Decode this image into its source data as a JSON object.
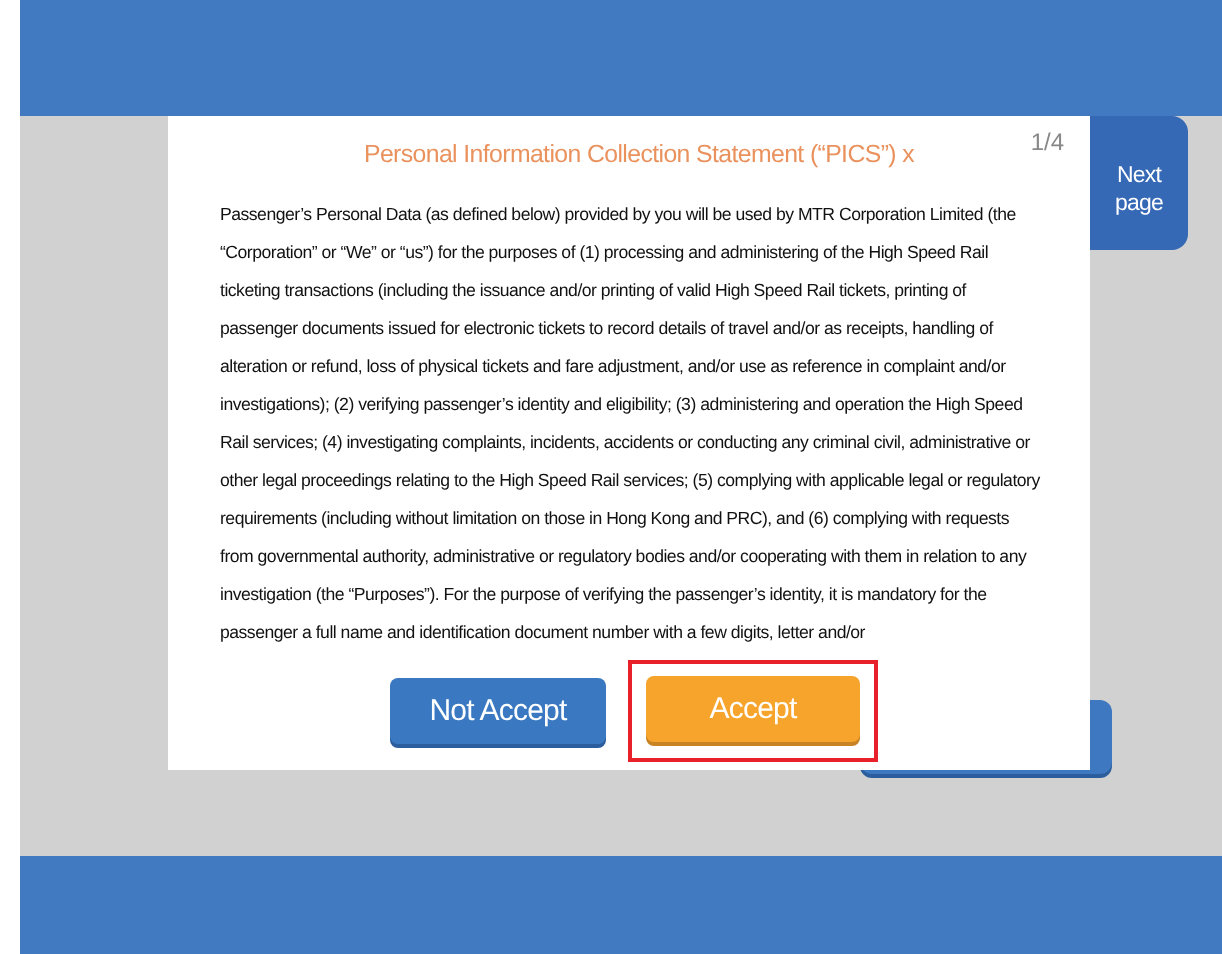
{
  "dialog": {
    "title": "Personal Information Collection Statement (“PICS”) x",
    "page_indicator": "1/4",
    "body": "Passenger’s Personal Data (as defined below) provided by you will be used by MTR Corporation Limited (the “Corporation” or “We” or “us”) for the purposes of (1) processing and administering of the High Speed Rail ticketing transactions (including the issuance and/or printing of valid High Speed Rail tickets, printing of passenger documents issued for electronic tickets to record details of travel and/or as receipts, handling of alteration or refund, loss of physical tickets and fare adjustment, and/or use as reference in complaint and/or investigations); (2) verifying passenger’s identity and eligibility; (3) administering and operation the High Speed Rail services; (4) investigating complaints, incidents, accidents or conducting any criminal civil, administrative or other legal proceedings relating to the High Speed Rail services; (5) complying with applicable legal or regulatory requirements (including without limitation on those in Hong Kong and PRC), and (6) complying with requests from governmental authority, administrative or regulatory bodies and/or cooperating with them in relation to any investigation (the “Purposes”). For the purpose of verifying the passenger’s identity, it is mandatory for the passenger a full name and identification document number with a few digits, letter and/or",
    "buttons": [
      {
        "label": "Not Accept",
        "kind": "secondary",
        "highlighted": false
      },
      {
        "label": "Accept",
        "kind": "primary",
        "highlighted": true
      }
    ]
  },
  "next_page": {
    "label": "Next page"
  }
}
